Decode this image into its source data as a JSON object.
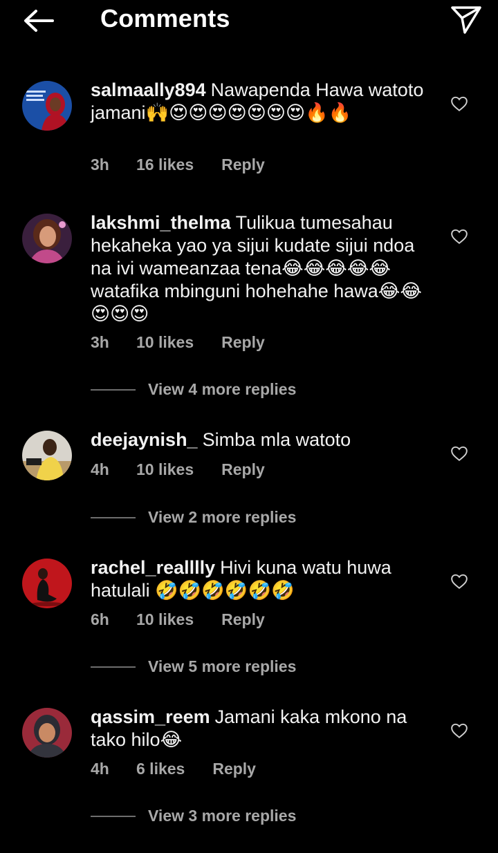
{
  "header": {
    "title": "Comments"
  },
  "comments": [
    {
      "username": "salmaally894",
      "text": "Nawapenda Hawa watoto jamani🙌😍😍😍😍😍😍😍🔥🔥",
      "time": "3h",
      "likes": "16 likes",
      "reply": "Reply"
    },
    {
      "username": "lakshmi_thelma",
      "text": "Tulikua tumesahau hekaheka yao ya sijui kudate sijui ndoa na ivi wameanzaa tena😂😂😂😂😂 watafika mbinguni hohehahe hawa😂😂😍😍😍",
      "time": "3h",
      "likes": "10 likes",
      "reply": "Reply",
      "view_more": "View 4 more replies"
    },
    {
      "username": "deejaynish_",
      "text": "Simba mla watoto",
      "time": "4h",
      "likes": "10 likes",
      "reply": "Reply",
      "view_more": "View 2 more replies"
    },
    {
      "username": "rachel_realllly",
      "text": "Hivi kuna watu huwa hatulali 🤣🤣🤣🤣🤣🤣",
      "time": "6h",
      "likes": "10 likes",
      "reply": "Reply",
      "view_more": "View 5 more replies"
    },
    {
      "username": "qassim_reem",
      "text": "Jamani kaka mkono na tako hilo😂",
      "time": "4h",
      "likes": "6 likes",
      "reply": "Reply",
      "view_more": "View 3 more replies"
    }
  ]
}
